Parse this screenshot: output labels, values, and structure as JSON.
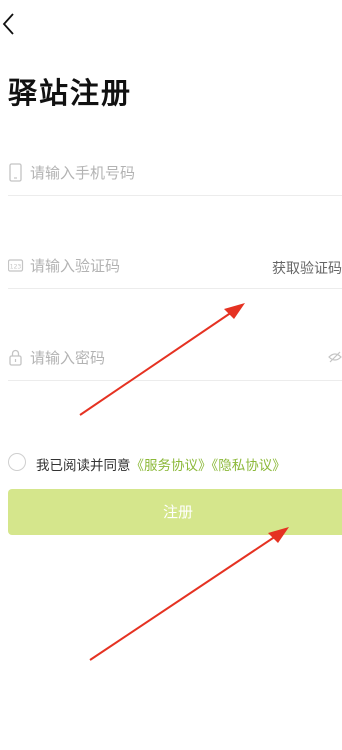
{
  "header": {
    "title": "驿站注册"
  },
  "form": {
    "phone_placeholder": "请输入手机号码",
    "code_placeholder": "请输入验证码",
    "get_code_label": "获取验证码",
    "password_placeholder": "请输入密码"
  },
  "agreement": {
    "prefix": "我已阅读并同意",
    "service_link": "《服务协议》",
    "privacy_link": "《隐私协议》"
  },
  "actions": {
    "register_label": "注册"
  },
  "colors": {
    "accent": "#8cb93a",
    "register_button": "#d5e68c",
    "annotation_arrow": "#e53222"
  },
  "icons": {
    "back": "chevron-left-icon",
    "phone": "phone-icon",
    "code": "numeric-keypad-icon",
    "lock": "lock-icon",
    "eye": "eye-off-icon"
  }
}
